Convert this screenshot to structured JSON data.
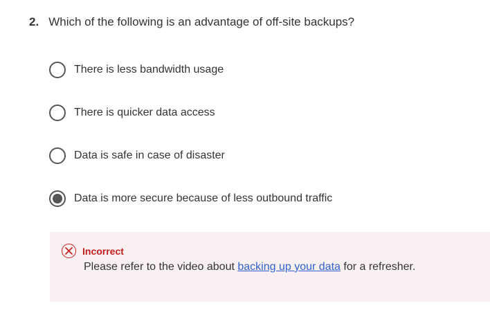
{
  "question": {
    "number": "2.",
    "text": "Which of the following is an advantage of off-site backups?"
  },
  "options": [
    {
      "label": "There is less bandwidth usage",
      "selected": false
    },
    {
      "label": "There is quicker data access",
      "selected": false
    },
    {
      "label": "Data is safe in case of disaster",
      "selected": false
    },
    {
      "label": "Data is more secure because of less outbound traffic",
      "selected": true
    }
  ],
  "feedback": {
    "status": "Incorrect",
    "text_before": "Please refer to the video about ",
    "link_text": "backing up your data",
    "text_after": " for a refresher.",
    "status_color": "#c41b1b",
    "background": "#f9f1f1"
  }
}
